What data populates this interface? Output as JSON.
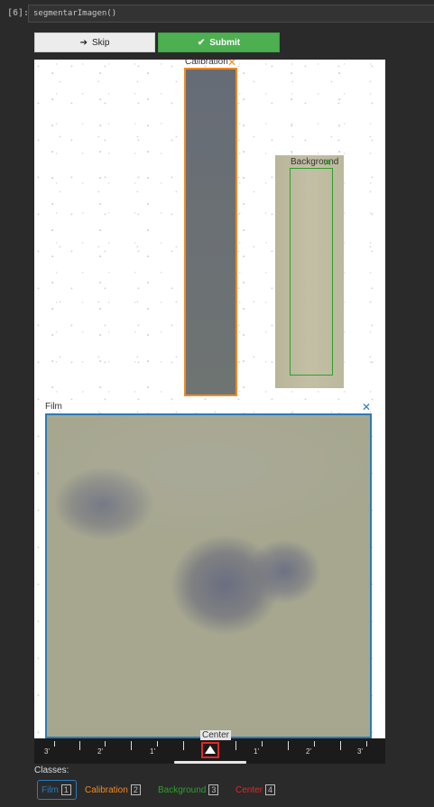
{
  "cell": {
    "prompt": "[6]:",
    "code": "segmentarImagen()"
  },
  "toolbar": {
    "skip_label": "Skip",
    "skip_icon": "arrow-right",
    "submit_label": "Submit",
    "submit_icon": "check"
  },
  "annotations": {
    "calibration": {
      "label": "Calibration",
      "color": "#f08a24"
    },
    "background": {
      "label": "Background",
      "color": "#2ca02c"
    },
    "film": {
      "label": "Film",
      "color": "#2b7bb9"
    },
    "center": {
      "label": "Center",
      "color": "#e02828"
    }
  },
  "ruler": {
    "labels": [
      "3'",
      "2'",
      "1'",
      "1'",
      "2'",
      "3'"
    ]
  },
  "classes": {
    "title": "Classes:",
    "items": [
      {
        "label": "Film",
        "key": "1",
        "color": "#2b7bb9",
        "selected": true
      },
      {
        "label": "Calibration",
        "key": "2",
        "color": "#f08a24",
        "selected": false
      },
      {
        "label": "Background",
        "key": "3",
        "color": "#2ca02c",
        "selected": false
      },
      {
        "label": "Center",
        "key": "4",
        "color": "#e02828",
        "selected": false
      }
    ]
  },
  "close_glyph": "✕"
}
